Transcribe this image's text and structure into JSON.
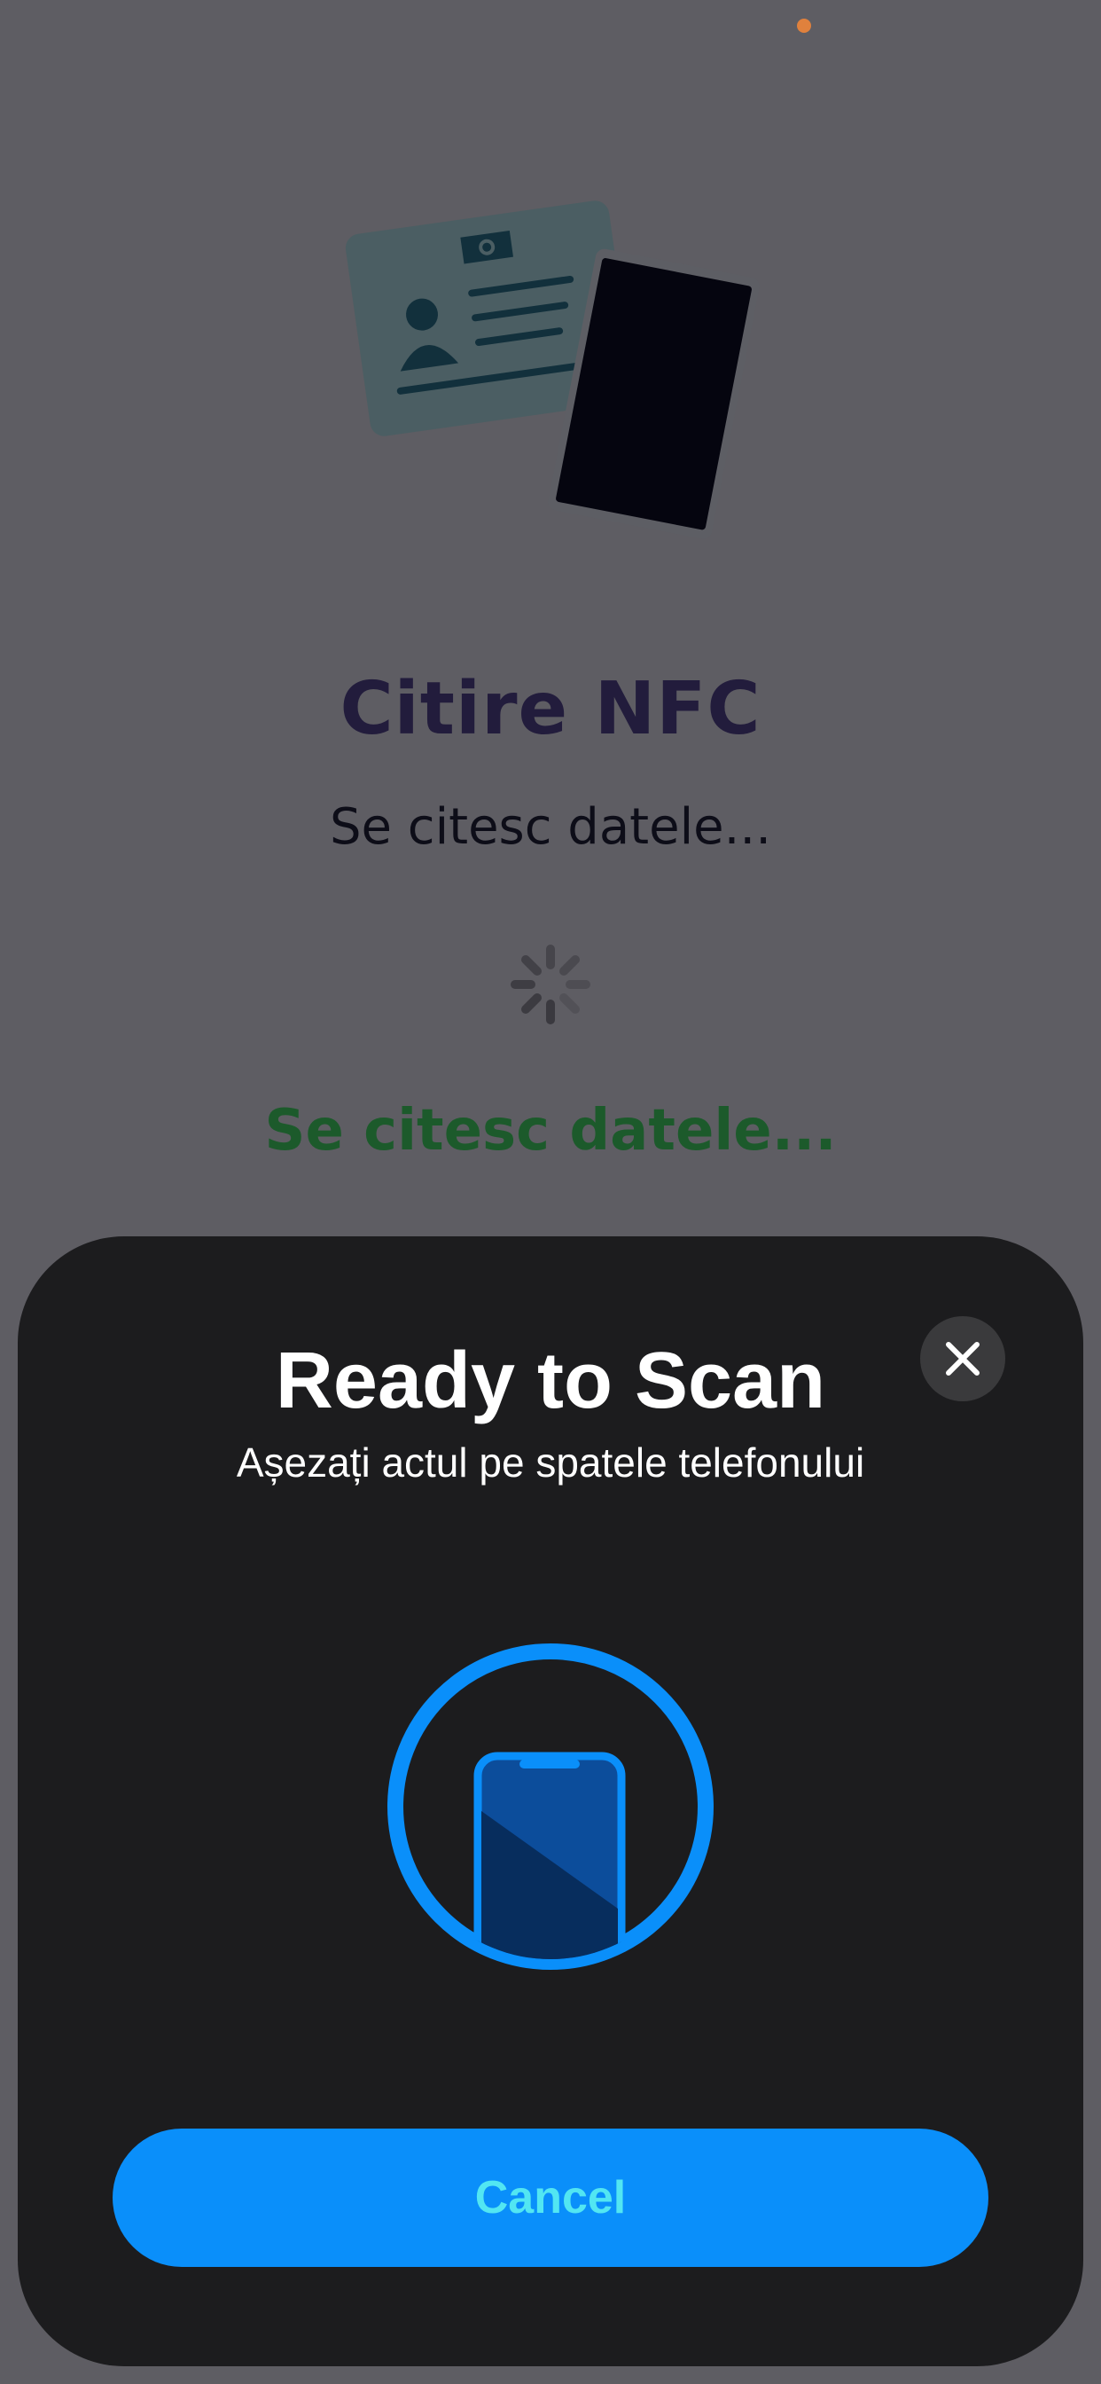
{
  "page": {
    "title": "Citire NFC",
    "subtitle": "Se citesc datele...",
    "status_text": "Se citesc datele..."
  },
  "icons": {
    "illustration": "id-card-and-phone-illustration",
    "spinner": "loading-spinner-icon",
    "scan": "phone-in-circle-icon",
    "close": "close-icon"
  },
  "nfc_sheet": {
    "title": "Ready to Scan",
    "message": "Așezați actul pe spatele telefonului",
    "cancel_label": "Cancel"
  },
  "colors": {
    "background": "#5e5d63",
    "sheet": "#1c1c1e",
    "accent_blue": "#0a8ffa",
    "status_green": "#1c5a2b",
    "title": "#221c3c"
  }
}
